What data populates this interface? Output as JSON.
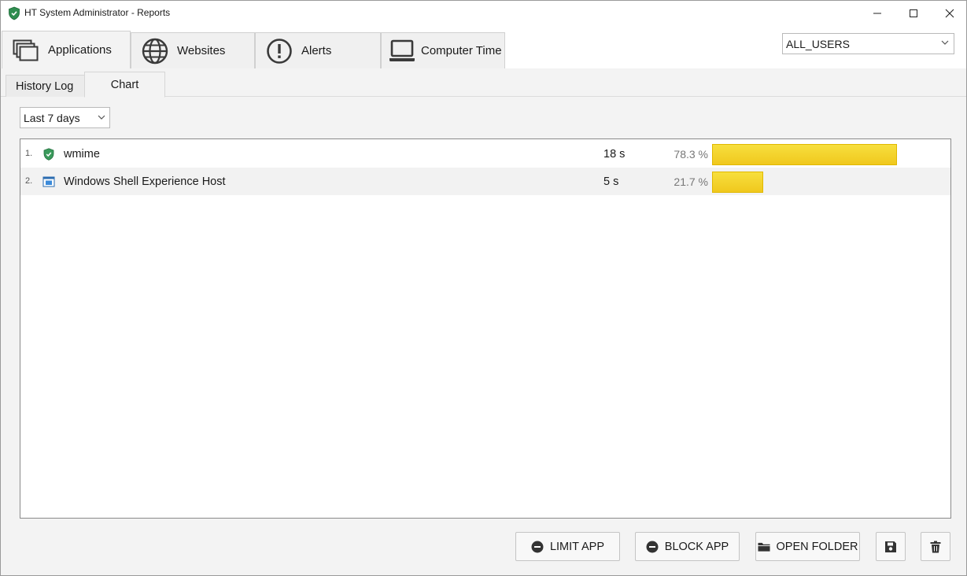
{
  "window": {
    "title": "HT System Administrator - Reports",
    "minimize_glyph": "—",
    "maximize_glyph": "☐",
    "close_glyph": "✕"
  },
  "main_tabs": [
    {
      "label": "Applications",
      "icon": "applications-icon",
      "active": true
    },
    {
      "label": "Websites",
      "icon": "globe-icon",
      "active": false
    },
    {
      "label": "Alerts",
      "icon": "alert-icon",
      "active": false
    },
    {
      "label": "Computer Time",
      "icon": "laptop-icon",
      "active": false
    }
  ],
  "user_select": {
    "value": "ALL_USERS"
  },
  "sub_tabs": [
    {
      "label": "History Log",
      "active": false
    },
    {
      "label": "Chart",
      "active": true
    }
  ],
  "period_select": {
    "value": "Last 7 days"
  },
  "rows": [
    {
      "num": "1.",
      "name": "wmime",
      "duration": "18 s",
      "percent_text": "78.3 %",
      "percent": 78.3,
      "icon": "shield-icon"
    },
    {
      "num": "2.",
      "name": "Windows Shell Experience Host",
      "duration": "5 s",
      "percent_text": "21.7 %",
      "percent": 21.7,
      "icon": "window-app-icon"
    }
  ],
  "buttons": {
    "limit": "LIMIT APP",
    "block": "BLOCK APP",
    "open_folder": "OPEN FOLDER"
  },
  "colors": {
    "bar": "#f0c81d",
    "shield": "#3a9a5b"
  }
}
